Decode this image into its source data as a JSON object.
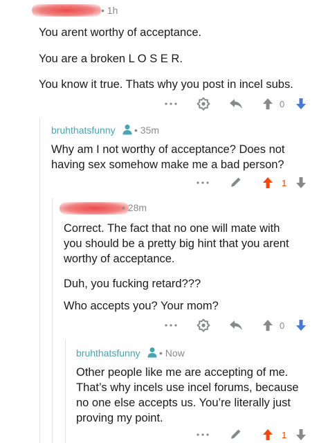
{
  "comments": [
    {
      "username_redacted": "",
      "time": "1h",
      "paragraphs": [
        "You arent worthy of acceptance.",
        "You are a broken L O S E R.",
        "You know it true.  Thats why you post in incel subs."
      ],
      "votes": "0",
      "upvoted": false
    },
    {
      "username": "bruhthatsfunny",
      "time": "35m",
      "paragraphs": [
        "Why am I not worthy of acceptance? Does not",
        "having sex somehow make me a bad person?"
      ],
      "votes": "1",
      "upvoted": true
    },
    {
      "username_redacted": "",
      "time": "28m",
      "paragraphs": [
        "Correct.  The fact that no one will mate with",
        "you should be a pretty big hint that you arent",
        "worthy of acceptance.",
        "Duh, you fucking retard???",
        "Who accepts you? Your mom?"
      ],
      "votes": "0",
      "upvoted": false
    },
    {
      "username": "bruhthatsfunny",
      "time": "Now",
      "paragraphs": [
        "Other people like me are accepting of me.",
        "That’s why incels use incel forums, because",
        "no one else accepts us. You’re literally just",
        "proving my point."
      ],
      "votes": "1",
      "upvoted": true
    }
  ],
  "icons": {
    "more": "more-dots-icon",
    "award": "award-icon",
    "reply": "reply-arrow-icon",
    "edit": "pencil-edit-icon",
    "user": "user-person-icon",
    "upvote": "upvote-arrow-icon",
    "downvote": "downvote-arrow-icon"
  },
  "colors": {
    "username": "#46a5b4",
    "upvote_active": "#ff4500",
    "downvote": "#4a78d6",
    "thread_line": "#e2e2e2",
    "meta": "#8a8a8a"
  }
}
